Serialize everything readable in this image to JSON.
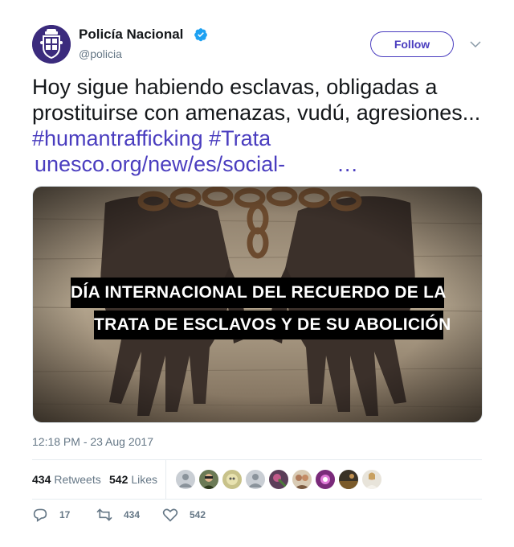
{
  "author": {
    "name": "Policía Nacional",
    "handle": "@policia",
    "verified_icon": "verified-badge-icon",
    "verified_color": "#1da1f2"
  },
  "follow_label": "Follow",
  "tweet": {
    "text_plain": "Hoy sigue habiendo esclavas, obligadas a prostituirse con amenazas, vudú, agresiones...",
    "hashtag1": "#humantrafficking",
    "hashtag2": "#Trata",
    "link": "unesco.org/new/es/social-",
    "ellipsis": "…"
  },
  "media": {
    "caption_line1": "DÍA INTERNACIONAL DEL RECUERDO DE LA",
    "caption_line2": "TRATA DE ESCLAVOS Y DE SU ABOLICIÓN"
  },
  "timestamp": "12:18 PM - 23 Aug 2017",
  "stats": {
    "retweets_count": "434",
    "retweets_label": "Retweets",
    "likes_count": "542",
    "likes_label": "Likes"
  },
  "actions": {
    "reply_count": "17",
    "retweet_count": "434",
    "like_count": "542"
  },
  "colors": {
    "accent": "#4a3dbf",
    "muted": "#657786"
  }
}
